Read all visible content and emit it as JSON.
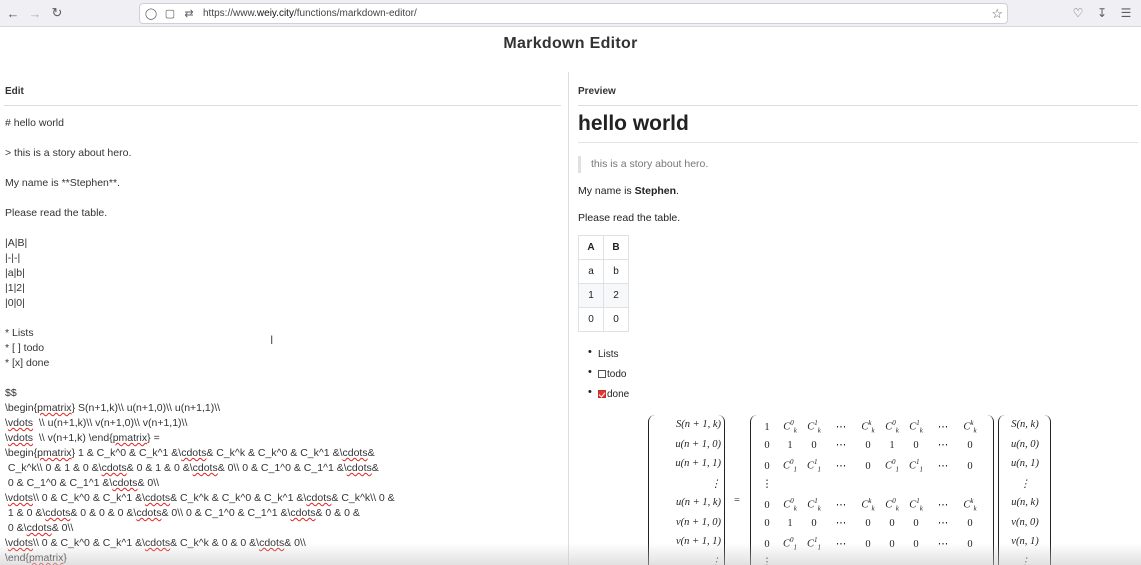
{
  "browser": {
    "url_prefix": "https://www.",
    "url_host": "weiy.city",
    "url_path": "/functions/markdown-editor/"
  },
  "page": {
    "title": "Markdown Editor"
  },
  "edit": {
    "heading": "Edit",
    "lines": [
      "# hello world",
      "",
      "> this is a story about hero.",
      "",
      "My name is **Stephen**.",
      "",
      "Please read the table.",
      "",
      "|A|B|",
      "|-|-|",
      "|a|b|",
      "|1|2|",
      "|0|0|",
      "",
      "* Lists",
      "* [ ] todo",
      "* [x] done",
      "",
      "$$",
      "\\begin{pmatrix} S(n+1,k)\\\\ u(n+1,0)\\\\ u(n+1,1)\\\\",
      "\\vdots  \\\\ u(n+1,k)\\\\ v(n+1,0)\\\\ v(n+1,1)\\\\",
      "\\vdots  \\\\ v(n+1,k) \\end{pmatrix} =",
      "\\begin{pmatrix} 1 & C_k^0 & C_k^1 &\\cdots& C_k^k & C_k^0 & C_k^1 &\\cdots&",
      " C_k^k\\\\ 0 & 1 & 0 &\\cdots& 0 & 1 & 0 &\\cdots& 0\\\\ 0 & C_1^0 & C_1^1 &\\cdots&",
      " 0 & C_1^0 & C_1^1 &\\cdots& 0\\\\",
      "\\vdots\\\\ 0 & C_k^0 & C_k^1 &\\cdots& C_k^k & C_k^0 & C_k^1 &\\cdots& C_k^k\\\\ 0 &",
      " 1 & 0 &\\cdots& 0 & 0 & 0 &\\cdots& 0\\\\ 0 & C_1^0 & C_1^1 &\\cdots& 0 & 0 &",
      " 0 &\\cdots& 0\\\\",
      "\\vdots\\\\ 0 & C_k^0 & C_k^1 &\\cdots& C_k^k & 0 & 0 &\\cdots& 0\\\\",
      "\\end{pmatrix}"
    ]
  },
  "preview": {
    "heading": "Preview",
    "h1": "hello world",
    "quote": "this is a story about hero.",
    "name_prefix": "My name is ",
    "name_bold": "Stephen",
    "name_suffix": ".",
    "table_intro": "Please read the table.",
    "table": {
      "headers": [
        "A",
        "B"
      ],
      "rows": [
        [
          "a",
          "b"
        ],
        [
          "1",
          "2"
        ],
        [
          "0",
          "0"
        ]
      ]
    },
    "list": {
      "item1": "Lists",
      "item2": "todo",
      "item3": "done"
    },
    "math": {
      "lhs": [
        "S(n + 1, k)",
        "u(n + 1, 0)",
        "u(n + 1, 1)",
        "⋮",
        "u(n + 1, k)",
        "v(n + 1, 0)",
        "v(n + 1, 1)",
        "⋮"
      ],
      "rhs_vec": [
        "S(n, k)",
        "u(n, 0)",
        "u(n, 1)",
        "⋮",
        "u(n, k)",
        "v(n, 0)",
        "v(n, 1)",
        "⋮"
      ],
      "eq": "="
    }
  }
}
